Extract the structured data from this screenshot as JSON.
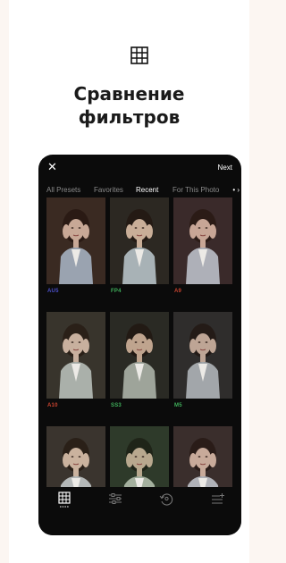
{
  "header": {
    "title_line1": "Сравнение",
    "title_line2": "фильтров",
    "grid_icon": "grid-icon"
  },
  "topbar": {
    "close_label": "✕",
    "next_label": "Next"
  },
  "tabs": [
    {
      "label": "All Presets",
      "active": false
    },
    {
      "label": "Favorites",
      "active": false
    },
    {
      "label": "Recent",
      "active": true
    },
    {
      "label": "For This Photo",
      "active": false
    }
  ],
  "more_tabs_indicator": "• ›",
  "presets": [
    {
      "label": "AU5",
      "color": "#4b4fc8"
    },
    {
      "label": "FP4",
      "color": "#3fae5a"
    },
    {
      "label": "A9",
      "color": "#c8432f"
    },
    {
      "label": "A10",
      "color": "#c8432f"
    },
    {
      "label": "SS3",
      "color": "#3fae5a"
    },
    {
      "label": "M5",
      "color": "#3fae5a"
    },
    {
      "label": "",
      "color": "#888888"
    },
    {
      "label": "",
      "color": "#888888"
    },
    {
      "label": "",
      "color": "#888888"
    }
  ],
  "bottom_nav": [
    {
      "icon": "grid-icon",
      "active": true
    },
    {
      "icon": "sliders-icon",
      "active": false
    },
    {
      "icon": "history-icon",
      "active": false
    },
    {
      "icon": "recipe-list-icon",
      "active": false
    }
  ],
  "colors": {
    "background": "#fcf6f2",
    "phone": "#0b0b0b",
    "tab_inactive": "#8a8a8a",
    "tab_active": "#ffffff"
  }
}
